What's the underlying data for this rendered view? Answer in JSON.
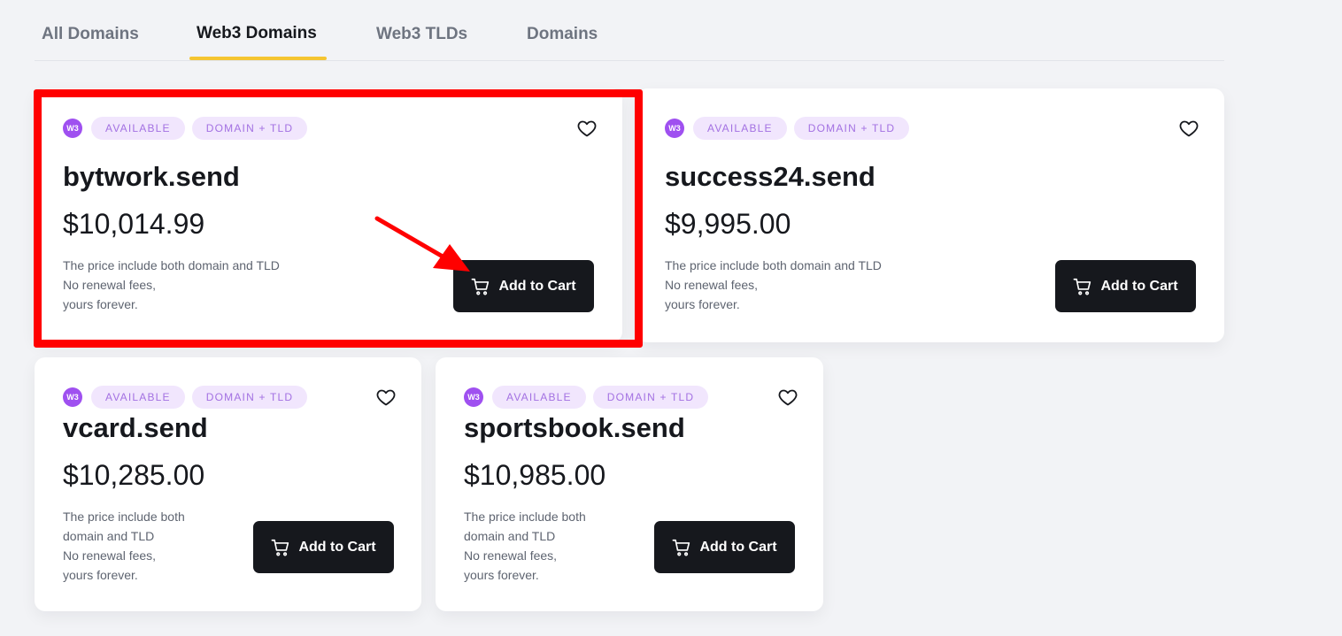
{
  "tabs": [
    {
      "label": "All Domains",
      "active": false
    },
    {
      "label": "Web3 Domains",
      "active": true
    },
    {
      "label": "Web3 TLDs",
      "active": false
    },
    {
      "label": "Domains",
      "active": false
    }
  ],
  "badge_labels": {
    "w3": "W3",
    "available": "AVAILABLE",
    "domain_tld": "DOMAIN + TLD"
  },
  "cards": [
    {
      "name": "bytwork.send",
      "price": "$10,014.99",
      "note_lines": [
        "The price include both domain and TLD",
        "No renewal fees,",
        "yours forever."
      ],
      "button": "Add to Cart",
      "highlighted": true
    },
    {
      "name": "success24.send",
      "price": "$9,995.00",
      "note_lines": [
        "The price include both domain and TLD",
        "No renewal fees,",
        "yours forever."
      ],
      "button": "Add to Cart",
      "highlighted": false
    },
    {
      "name": "vcard.send",
      "price": "$10,285.00",
      "note_lines": [
        "The price include both",
        "domain and TLD",
        "No renewal fees,",
        "yours forever."
      ],
      "button": "Add to Cart",
      "highlighted": false
    },
    {
      "name": "sportsbook.send",
      "price": "$10,985.00",
      "note_lines": [
        "The price include both",
        "domain and TLD",
        "No renewal fees,",
        "yours forever."
      ],
      "button": "Add to Cart",
      "highlighted": false
    }
  ],
  "colors": {
    "tab_underline": "#f5c531",
    "badge_bg": "#f1e6fd",
    "badge_text": "#a371e2",
    "w3_icon": "#9f50f0",
    "button_bg": "#16181d",
    "annotation": "#ff0000"
  },
  "icons": {
    "favorite": "heart-icon",
    "cart": "cart-icon",
    "web3": "w3-icon"
  }
}
